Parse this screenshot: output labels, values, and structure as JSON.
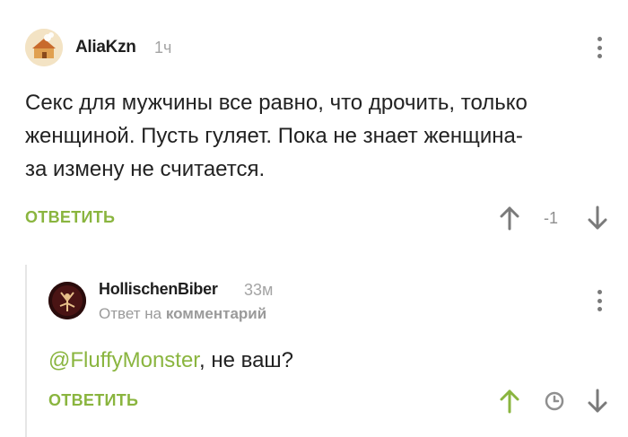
{
  "comments": [
    {
      "author": "AliaKzn",
      "time": "1ч",
      "text_lines": [
        "Секс для мужчины все равно, что дрочить, только",
        "женщиной. Пусть гуляет. Пока не знает женщина-",
        "за измену не считается."
      ],
      "reply_label": "ОТВЕТИТЬ",
      "rating": "-1"
    },
    {
      "author": "HollischenBiber",
      "time": "33м",
      "reply_prefix": "Ответ на",
      "reply_link": "комментарий",
      "mention": "@FluffyMonster",
      "text_rest": ", не ваш?",
      "reply_label": "ОТВЕТИТЬ"
    }
  ],
  "colors": {
    "accent": "#8ab53f",
    "upvote_active": "#8ab53f",
    "muted": "#a4a4a4"
  },
  "icons": {
    "up": "arrow-up-icon",
    "down": "arrow-down-icon",
    "menu": "more-vertical-icon",
    "clock": "clock-icon"
  }
}
